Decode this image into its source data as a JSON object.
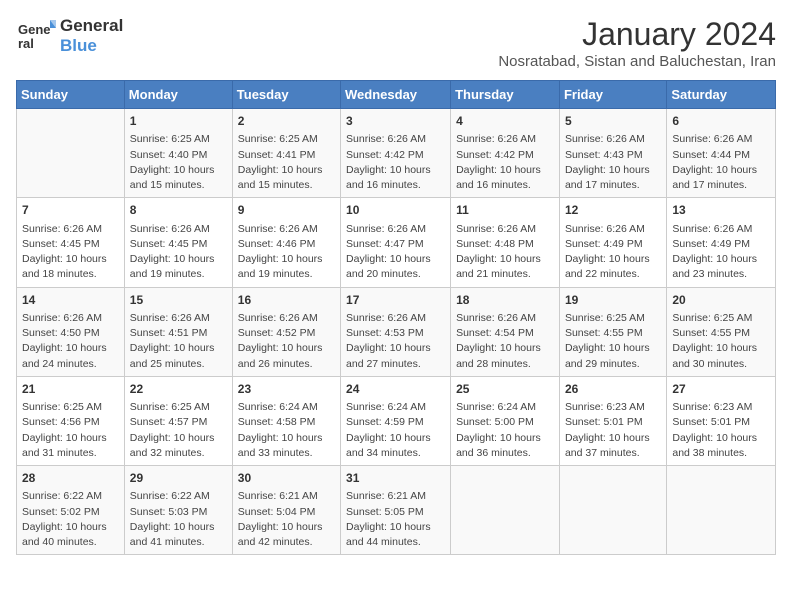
{
  "header": {
    "logo_general": "General",
    "logo_blue": "Blue",
    "month_year": "January 2024",
    "location": "Nosratabad, Sistan and Baluchestan, Iran"
  },
  "weekdays": [
    "Sunday",
    "Monday",
    "Tuesday",
    "Wednesday",
    "Thursday",
    "Friday",
    "Saturday"
  ],
  "weeks": [
    [
      {
        "day": "",
        "info": ""
      },
      {
        "day": "1",
        "info": "Sunrise: 6:25 AM\nSunset: 4:40 PM\nDaylight: 10 hours and 15 minutes."
      },
      {
        "day": "2",
        "info": "Sunrise: 6:25 AM\nSunset: 4:41 PM\nDaylight: 10 hours and 15 minutes."
      },
      {
        "day": "3",
        "info": "Sunrise: 6:26 AM\nSunset: 4:42 PM\nDaylight: 10 hours and 16 minutes."
      },
      {
        "day": "4",
        "info": "Sunrise: 6:26 AM\nSunset: 4:42 PM\nDaylight: 10 hours and 16 minutes."
      },
      {
        "day": "5",
        "info": "Sunrise: 6:26 AM\nSunset: 4:43 PM\nDaylight: 10 hours and 17 minutes."
      },
      {
        "day": "6",
        "info": "Sunrise: 6:26 AM\nSunset: 4:44 PM\nDaylight: 10 hours and 17 minutes."
      }
    ],
    [
      {
        "day": "7",
        "info": "Sunrise: 6:26 AM\nSunset: 4:45 PM\nDaylight: 10 hours and 18 minutes."
      },
      {
        "day": "8",
        "info": "Sunrise: 6:26 AM\nSunset: 4:45 PM\nDaylight: 10 hours and 19 minutes."
      },
      {
        "day": "9",
        "info": "Sunrise: 6:26 AM\nSunset: 4:46 PM\nDaylight: 10 hours and 19 minutes."
      },
      {
        "day": "10",
        "info": "Sunrise: 6:26 AM\nSunset: 4:47 PM\nDaylight: 10 hours and 20 minutes."
      },
      {
        "day": "11",
        "info": "Sunrise: 6:26 AM\nSunset: 4:48 PM\nDaylight: 10 hours and 21 minutes."
      },
      {
        "day": "12",
        "info": "Sunrise: 6:26 AM\nSunset: 4:49 PM\nDaylight: 10 hours and 22 minutes."
      },
      {
        "day": "13",
        "info": "Sunrise: 6:26 AM\nSunset: 4:49 PM\nDaylight: 10 hours and 23 minutes."
      }
    ],
    [
      {
        "day": "14",
        "info": "Sunrise: 6:26 AM\nSunset: 4:50 PM\nDaylight: 10 hours and 24 minutes."
      },
      {
        "day": "15",
        "info": "Sunrise: 6:26 AM\nSunset: 4:51 PM\nDaylight: 10 hours and 25 minutes."
      },
      {
        "day": "16",
        "info": "Sunrise: 6:26 AM\nSunset: 4:52 PM\nDaylight: 10 hours and 26 minutes."
      },
      {
        "day": "17",
        "info": "Sunrise: 6:26 AM\nSunset: 4:53 PM\nDaylight: 10 hours and 27 minutes."
      },
      {
        "day": "18",
        "info": "Sunrise: 6:26 AM\nSunset: 4:54 PM\nDaylight: 10 hours and 28 minutes."
      },
      {
        "day": "19",
        "info": "Sunrise: 6:25 AM\nSunset: 4:55 PM\nDaylight: 10 hours and 29 minutes."
      },
      {
        "day": "20",
        "info": "Sunrise: 6:25 AM\nSunset: 4:55 PM\nDaylight: 10 hours and 30 minutes."
      }
    ],
    [
      {
        "day": "21",
        "info": "Sunrise: 6:25 AM\nSunset: 4:56 PM\nDaylight: 10 hours and 31 minutes."
      },
      {
        "day": "22",
        "info": "Sunrise: 6:25 AM\nSunset: 4:57 PM\nDaylight: 10 hours and 32 minutes."
      },
      {
        "day": "23",
        "info": "Sunrise: 6:24 AM\nSunset: 4:58 PM\nDaylight: 10 hours and 33 minutes."
      },
      {
        "day": "24",
        "info": "Sunrise: 6:24 AM\nSunset: 4:59 PM\nDaylight: 10 hours and 34 minutes."
      },
      {
        "day": "25",
        "info": "Sunrise: 6:24 AM\nSunset: 5:00 PM\nDaylight: 10 hours and 36 minutes."
      },
      {
        "day": "26",
        "info": "Sunrise: 6:23 AM\nSunset: 5:01 PM\nDaylight: 10 hours and 37 minutes."
      },
      {
        "day": "27",
        "info": "Sunrise: 6:23 AM\nSunset: 5:01 PM\nDaylight: 10 hours and 38 minutes."
      }
    ],
    [
      {
        "day": "28",
        "info": "Sunrise: 6:22 AM\nSunset: 5:02 PM\nDaylight: 10 hours and 40 minutes."
      },
      {
        "day": "29",
        "info": "Sunrise: 6:22 AM\nSunset: 5:03 PM\nDaylight: 10 hours and 41 minutes."
      },
      {
        "day": "30",
        "info": "Sunrise: 6:21 AM\nSunset: 5:04 PM\nDaylight: 10 hours and 42 minutes."
      },
      {
        "day": "31",
        "info": "Sunrise: 6:21 AM\nSunset: 5:05 PM\nDaylight: 10 hours and 44 minutes."
      },
      {
        "day": "",
        "info": ""
      },
      {
        "day": "",
        "info": ""
      },
      {
        "day": "",
        "info": ""
      }
    ]
  ]
}
